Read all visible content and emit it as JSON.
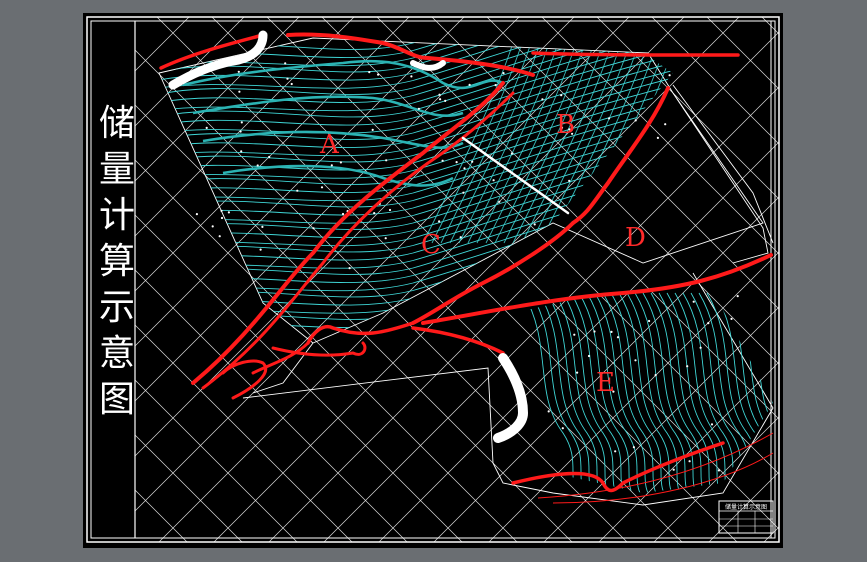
{
  "sheet": {
    "title": "储量计算示意图",
    "blocks": [
      "A",
      "B",
      "C",
      "D",
      "E"
    ],
    "title_block_text": "储量计算示意图"
  },
  "colors": {
    "background": "#000000",
    "frame": "#ffffff",
    "contours": "#3fd6d6",
    "ore_boundary": "#ff1a1a",
    "grid": "#ffffff",
    "viewport": "#6a6e72"
  }
}
